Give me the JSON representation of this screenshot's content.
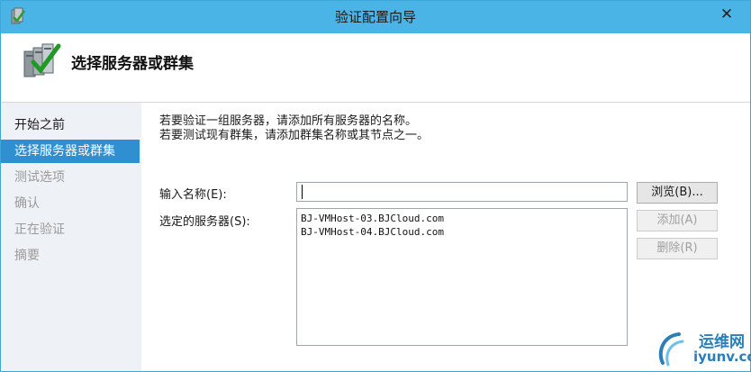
{
  "window": {
    "title": "验证配置向导",
    "close_glyph": "✕"
  },
  "header": {
    "title": "选择服务器或群集"
  },
  "nav": {
    "items": [
      {
        "label": "开始之前"
      },
      {
        "label": "选择服务器或群集"
      },
      {
        "label": "测试选项"
      },
      {
        "label": "确认"
      },
      {
        "label": "正在验证"
      },
      {
        "label": "摘要"
      }
    ]
  },
  "main": {
    "intro_line1": "若要验证一组服务器，请添加所有服务器的名称。",
    "intro_line2": "若要测试现有群集，请添加群集名称或其节点之一。",
    "name_label": "输入名称(E):",
    "name_value": "",
    "selected_label": "选定的服务器(S):",
    "selected_servers": [
      "BJ-VMHost-03.BJCloud.com",
      "BJ-VMHost-04.BJCloud.com"
    ],
    "browse_label": "浏览(B)...",
    "add_label": "添加(A)",
    "remove_label": "删除(R)"
  },
  "watermark": {
    "text_cn": "运维网",
    "url": "iyunv.com"
  },
  "colors": {
    "titlebar": "#49b4e5",
    "nav_active": "#2f8fd0",
    "nav_bg": "#eef1f5",
    "watermark": "#2a7fb8"
  }
}
